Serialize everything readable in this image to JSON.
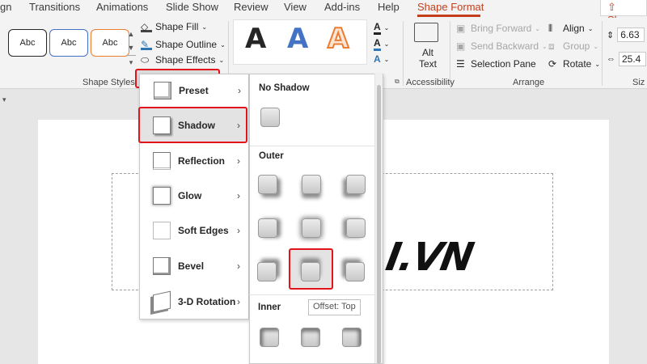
{
  "tabs": [
    {
      "label": "gn",
      "active": false
    },
    {
      "label": "Transitions",
      "active": false
    },
    {
      "label": "Animations",
      "active": false
    },
    {
      "label": "Slide Show",
      "active": false
    },
    {
      "label": "Review",
      "active": false
    },
    {
      "label": "View",
      "active": false
    },
    {
      "label": "Add-ins",
      "active": false
    },
    {
      "label": "Help",
      "active": false
    },
    {
      "label": "Shape Format",
      "active": true
    }
  ],
  "share_label": "Share",
  "accent_color": "#c43e1c",
  "highlight_color": "#e1141c",
  "shape_styles": {
    "group_label": "Shape Styles",
    "presets": [
      {
        "label": "Abc",
        "border": "#262626"
      },
      {
        "label": "Abc",
        "border": "#4472c4"
      },
      {
        "label": "Abc",
        "border": "#ed7d31"
      }
    ],
    "shape_fill": "Shape Fill",
    "shape_outline": "Shape Outline",
    "shape_effects": "Shape Effects"
  },
  "wordart": {
    "letters": [
      {
        "char": "A",
        "color": "#000000"
      },
      {
        "char": "A",
        "color": "#4472c4"
      },
      {
        "char": "A",
        "color": "#ed7d31"
      }
    ]
  },
  "accessibility": {
    "group_label": "Accessibility",
    "alt_text_line1": "Alt",
    "alt_text_line2": "Text"
  },
  "arrange": {
    "group_label": "Arrange",
    "bring_forward": "Bring Forward",
    "send_backward": "Send Backward",
    "selection_pane": "Selection Pane",
    "align": "Align",
    "group": "Group",
    "rotate": "Rotate"
  },
  "size": {
    "group_label": "Siz",
    "height": "6.63",
    "width": "25.4"
  },
  "effects_menu": {
    "items": [
      {
        "label": "Preset",
        "icon": "preset-icon"
      },
      {
        "label": "Shadow",
        "icon": "shadow-icon"
      },
      {
        "label": "Reflection",
        "icon": "reflection-icon"
      },
      {
        "label": "Glow",
        "icon": "glow-icon"
      },
      {
        "label": "Soft Edges",
        "icon": "soft-edges-icon"
      },
      {
        "label": "Bevel",
        "icon": "bevel-icon"
      },
      {
        "label": "3-D Rotation",
        "icon": "3d-rotation-icon"
      }
    ]
  },
  "shadow_panel": {
    "no_shadow": "No Shadow",
    "outer": "Outer",
    "inner": "Inner",
    "tooltip": "Offset: Top"
  },
  "slide": {
    "text": "I.VN"
  }
}
